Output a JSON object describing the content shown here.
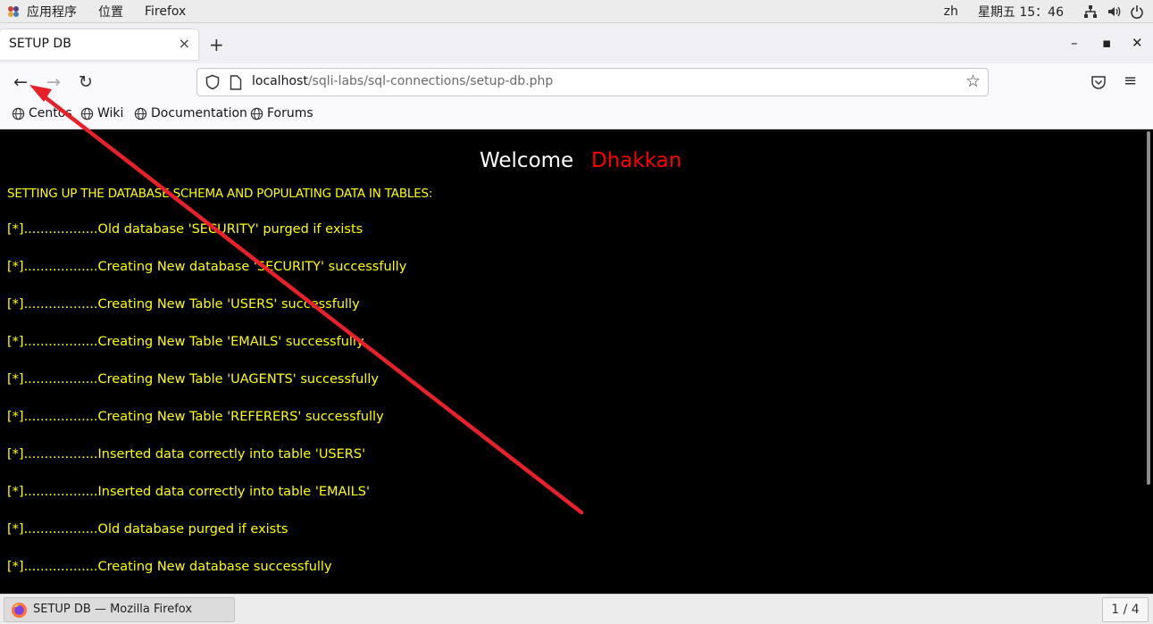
{
  "topbar": {
    "applications": "应用程序",
    "places": "位置",
    "app_name": "Firefox",
    "lang": "zh",
    "clock": "星期五 15：46"
  },
  "tab": {
    "title": "SETUP DB",
    "close": "×",
    "new_tab": "+"
  },
  "window_controls": {
    "minimize": "–",
    "maximize": "▪",
    "close": "✕"
  },
  "nav": {
    "back": "←",
    "forward": "→",
    "reload": "↻",
    "url_host": "localhost",
    "url_path": "/sqli-labs/sql-connections/setup-db.php",
    "star": "☆",
    "menu": "≡"
  },
  "bookmarks": [
    {
      "label": "Centos"
    },
    {
      "label": "Wiki"
    },
    {
      "label": "Documentation"
    },
    {
      "label": "Forums"
    }
  ],
  "page": {
    "welcome": "Welcome",
    "name": "Dhakkan",
    "heading": "SETTING UP THE DATABASE SCHEMA AND POPULATING DATA IN TABLES:",
    "lines": [
      "[*]..................Old database 'SECURITY' purged if exists",
      "[*]..................Creating New database 'SECURITY' successfully",
      "[*]..................Creating New Table 'USERS' successfully",
      "[*]..................Creating New Table 'EMAILS' successfully",
      "[*]..................Creating New Table 'UAGENTS' successfully",
      "[*]..................Creating New Table 'REFERERS' successfully",
      "[*]..................Inserted data correctly into table 'USERS'",
      "[*]..................Inserted data correctly into table 'EMAILS'",
      "[*]..................Old database purged if exists",
      "[*]..................Creating New database successfully"
    ]
  },
  "taskbar": {
    "window_title": "SETUP DB — Mozilla Firefox",
    "pager": "1 / 4"
  },
  "colors": {
    "content_bg": "#000000",
    "text_yellow": "#ffff00",
    "name_red": "#ff0000",
    "arrow_red": "#e8202a"
  }
}
